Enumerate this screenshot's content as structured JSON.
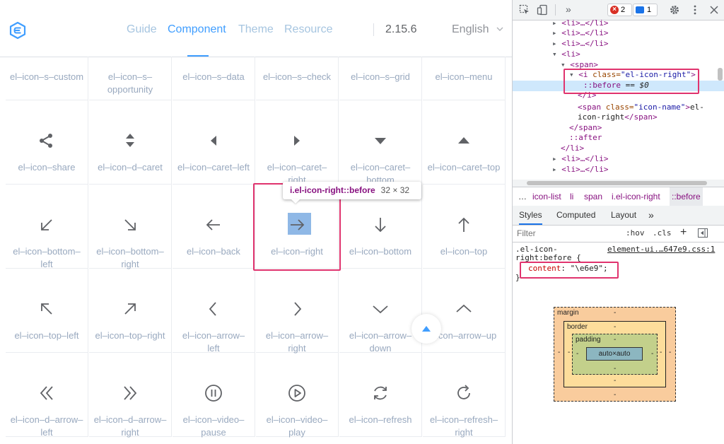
{
  "header": {
    "nav": [
      {
        "label": "Guide"
      },
      {
        "label": "Component"
      },
      {
        "label": "Theme"
      },
      {
        "label": "Resource"
      }
    ],
    "active_nav": "Component",
    "version": "2.15.6",
    "language": "English"
  },
  "icons": {
    "rows": [
      [
        "el-icon-s-custom",
        "el-icon-s-opportunity",
        "el-icon-s-data",
        "el-icon-s-check",
        "el-icon-s-grid",
        "el-icon-menu"
      ],
      [
        "el-icon-share",
        "el-icon-d-caret",
        "el-icon-caret-left",
        "el-icon-caret-right",
        "el-icon-caret-bottom",
        "el-icon-caret-top"
      ],
      [
        "el-icon-bottom-left",
        "el-icon-bottom-right",
        "el-icon-back",
        "el-icon-right",
        "el-icon-bottom",
        "el-icon-top"
      ],
      [
        "el-icon-top-left",
        "el-icon-top-right",
        "el-icon-arrow-left",
        "el-icon-arrow-right",
        "el-icon-arrow-down",
        "el-icon-arrow-up"
      ],
      [
        "el-icon-d-arrow-left",
        "el-icon-d-arrow-right",
        "el-icon-video-pause",
        "el-icon-video-play",
        "el-icon-refresh",
        "el-icon-refresh-right"
      ]
    ],
    "display_names": [
      [
        "el–icon–s–custom",
        "el–icon–s–\nopportunity",
        "el–icon–s–data",
        "el–icon–s–check",
        "el–icon–s–grid",
        "el–icon–menu"
      ],
      [
        "el–icon–share",
        "el–icon–d–caret",
        "el–icon–caret–left",
        "el–icon–caret–\nright",
        "el–icon–caret–\nbottom",
        "el–icon–caret–top"
      ],
      [
        "el–icon–bottom–\nleft",
        "el–icon–bottom–\nright",
        "el–icon–back",
        "el–icon–right",
        "el–icon–bottom",
        "el–icon–top"
      ],
      [
        "el–icon–top–left",
        "el–icon–top–right",
        "el–icon–arrow–\nleft",
        "el–icon–arrow–\nright",
        "el–icon–arrow–\ndown",
        "–icon–arrow–up"
      ],
      [
        "el–icon–d–arrow–\nleft",
        "el–icon–d–arrow–\nright",
        "el–icon–video–\npause",
        "el–icon–video–\nplay",
        "el–icon–refresh",
        "el–icon–refresh–\nright"
      ]
    ],
    "highlighted": "el-icon-right"
  },
  "tooltip": {
    "selector": "i.el-icon-right::before",
    "size": "32 × 32"
  },
  "devtools": {
    "errors_count": "2",
    "messages_count": "1",
    "more_label": "»",
    "tree": {
      "li_collapsed": "<li>…</li>",
      "li_open": "<li>",
      "span_open": "<span>",
      "i_tag": "<i",
      "i_attr": "class=",
      "i_val": "\"el-icon-right\"",
      "i_close": ">",
      "before": "::before",
      "before_eq": " == ",
      "before_ref": "$0",
      "i_end": "</i>",
      "span_inner_open": "<span",
      "span_inner_attr": "class=",
      "span_inner_val": "\"icon-name\"",
      "span_inner_text1": "el-",
      "span_inner_text2": "icon-right",
      "span_inner_close": "</span>",
      "span_end": "</span>",
      "after": "::after",
      "li_end": "</li>"
    },
    "breadcrumbs": [
      "…",
      "icon-list",
      "li",
      "span",
      "i.el-icon-right",
      "::before"
    ],
    "tabs": [
      "Styles",
      "Computed",
      "Layout",
      "»"
    ],
    "active_tab": "Styles",
    "filter_placeholder": "Filter",
    "hov": ":hov",
    "cls": ".cls",
    "plus": "+",
    "rule": {
      "selector_line1": ".el-icon-",
      "selector_line2": "right:before {",
      "source": "element-ui.…647e9.css:1",
      "property": "content",
      "value": "\"\\e6e9\"",
      "close": "}"
    },
    "box_model": {
      "margin_label": "margin",
      "border_label": "border",
      "padding_label": "padding",
      "content": "auto×auto",
      "dash": "-"
    }
  },
  "colors": {
    "accent": "#409eff",
    "highlight_box": "#e0336e"
  }
}
